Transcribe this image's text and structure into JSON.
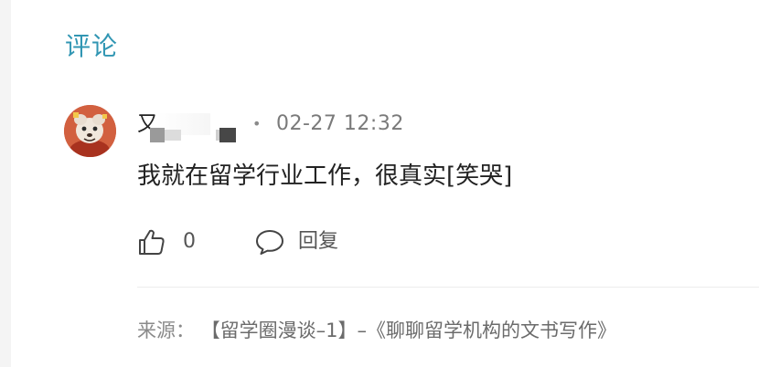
{
  "section": {
    "title": "评论"
  },
  "comment": {
    "avatar_icon": "cartoon-avatar",
    "username": "又",
    "separator": "•",
    "timestamp": "02-27 12:32",
    "text": "我就在留学行业工作，很真实[笑哭]",
    "actions": {
      "like_icon": "thumbs-up-icon",
      "like_count": "0",
      "reply_icon": "speech-bubble-icon",
      "reply_label": "回复"
    }
  },
  "source": {
    "label": "来源：",
    "title": "【留学圈漫谈–1】–《聊聊留学机构的文书写作》"
  },
  "colors": {
    "accent": "#3196b3",
    "text_primary": "#222222",
    "text_secondary": "#8a8a8a"
  }
}
